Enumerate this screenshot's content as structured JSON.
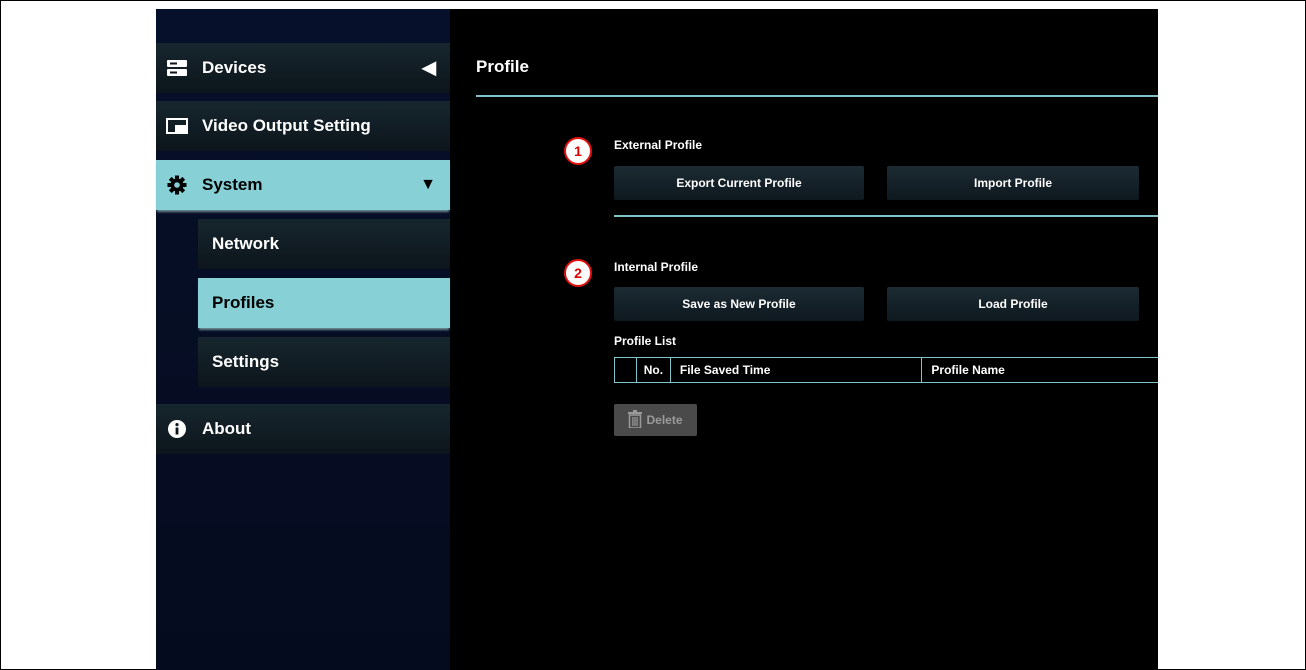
{
  "sidebar": {
    "items": [
      {
        "label": "Devices",
        "icon": "server-icon",
        "arrow": "◀"
      },
      {
        "label": "Video Output Setting",
        "icon": "video-output-icon"
      },
      {
        "label": "System",
        "icon": "gear-icon",
        "arrow": "▼"
      },
      {
        "label": "Network"
      },
      {
        "label": "Profiles"
      },
      {
        "label": "Settings"
      },
      {
        "label": "About",
        "icon": "info-icon"
      }
    ]
  },
  "main": {
    "title": "Profile",
    "external": {
      "badge": "1",
      "label": "External Profile",
      "export_label": "Export Current Profile",
      "import_label": "Import Profile"
    },
    "internal": {
      "badge": "2",
      "label": "Internal Profile",
      "save_label": "Save as New Profile",
      "load_label": "Load Profile",
      "list_label": "Profile List",
      "columns": [
        "",
        "No.",
        "File Saved Time",
        "Profile Name"
      ],
      "delete_label": "Delete"
    }
  },
  "colors": {
    "accent": "#86d0d6",
    "rule": "#7fc3c9",
    "badge": "#e01010"
  }
}
